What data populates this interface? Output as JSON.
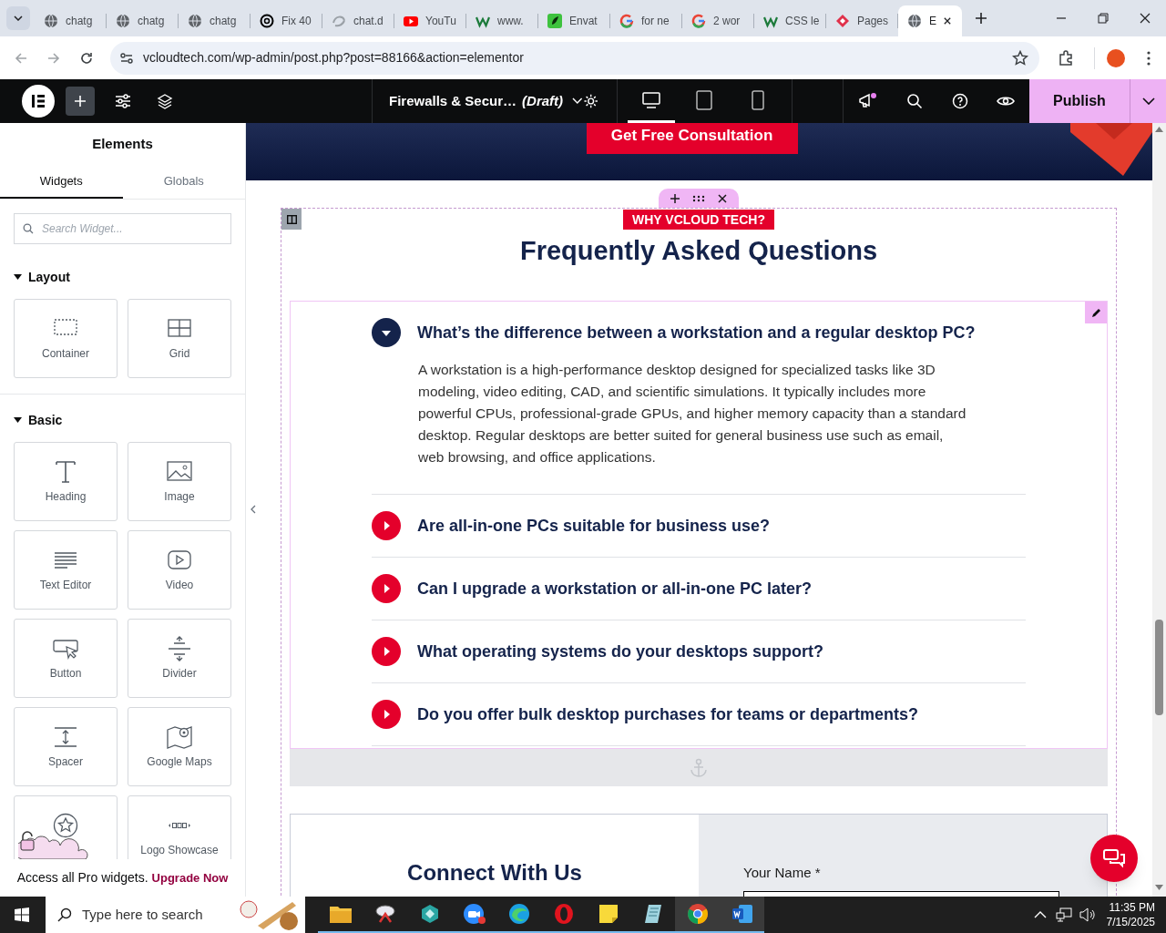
{
  "browser": {
    "tabs": [
      {
        "label": "chatg",
        "selected": false
      },
      {
        "label": "chatg",
        "selected": false
      },
      {
        "label": "chatg",
        "selected": false
      },
      {
        "label": "Fix 40",
        "selected": false
      },
      {
        "label": "chat.d",
        "selected": false
      },
      {
        "label": "YouTu",
        "selected": false
      },
      {
        "label": "www.",
        "selected": false
      },
      {
        "label": "Envat",
        "selected": false
      },
      {
        "label": "for ne",
        "selected": false
      },
      {
        "label": "2 wor",
        "selected": false
      },
      {
        "label": "CSS le",
        "selected": false
      },
      {
        "label": "Pages",
        "selected": false
      },
      {
        "label": "E",
        "selected": true
      }
    ],
    "url": "vcloudtech.com/wp-admin/post.php?post=88166&action=elementor"
  },
  "editor_bar": {
    "document_title": "Firewalls & Secur…",
    "status": "(Draft)",
    "devices": [
      {
        "kind": "desktop",
        "selected": true
      },
      {
        "kind": "tablet",
        "selected": false
      },
      {
        "kind": "mobile",
        "selected": false
      }
    ],
    "publish": "Publish"
  },
  "panel": {
    "title": "Elements",
    "tabs": [
      {
        "label": "Widgets",
        "selected": true
      },
      {
        "label": "Globals",
        "selected": false
      }
    ],
    "search": {
      "placeholder": "Search Widget..."
    },
    "sections": [
      {
        "title": "Layout",
        "expanded": true,
        "widgets": [
          {
            "kind": "container",
            "label": "Container"
          },
          {
            "kind": "grid",
            "label": "Grid"
          }
        ]
      },
      {
        "title": "Basic",
        "expanded": true,
        "widgets": [
          {
            "kind": "heading",
            "label": "Heading"
          },
          {
            "kind": "image",
            "label": "Image"
          },
          {
            "kind": "text-editor",
            "label": "Text Editor"
          },
          {
            "kind": "video",
            "label": "Video"
          },
          {
            "kind": "button",
            "label": "Button"
          },
          {
            "kind": "divider",
            "label": "Divider"
          },
          {
            "kind": "spacer",
            "label": "Spacer"
          },
          {
            "kind": "map",
            "label": "Google Maps"
          },
          {
            "kind": "star"
          },
          {
            "kind": "logos",
            "label": "Logo Showcase"
          }
        ]
      }
    ],
    "promo": {
      "text": "Access all Pro widgets.",
      "link": "Upgrade Now"
    }
  },
  "canvas": {
    "cta": "Get Free Consultation",
    "badge": "WHY VCLOUD TECH?",
    "heading": "Frequently Asked Questions",
    "faq": [
      {
        "question": "What’s the difference between a workstation and a regular desktop PC?",
        "expanded": true,
        "answer": "A workstation is a high-performance desktop designed for specialized tasks like 3D modeling, video editing, CAD, and scientific simulations. It typically includes more powerful CPUs, professional-grade GPUs, and higher memory capacity than a standard desktop. Regular desktops are better suited for general business use such as email, web browsing, and office applications."
      },
      {
        "question": "Are all-in-one PCs suitable for business use?",
        "expanded": false
      },
      {
        "question": "Can I upgrade a workstation or all-in-one PC later?",
        "expanded": false
      },
      {
        "question": "What operating systems do your desktops support?",
        "expanded": false
      },
      {
        "question": "Do you offer bulk desktop purchases for teams or departments?",
        "expanded": false
      }
    ],
    "contact": {
      "heading": "Connect With Us",
      "field_label": "Your Name *"
    }
  },
  "taskbar": {
    "search_placeholder": "Type here to search",
    "time": "11:35 PM",
    "date": "7/15/2025"
  }
}
